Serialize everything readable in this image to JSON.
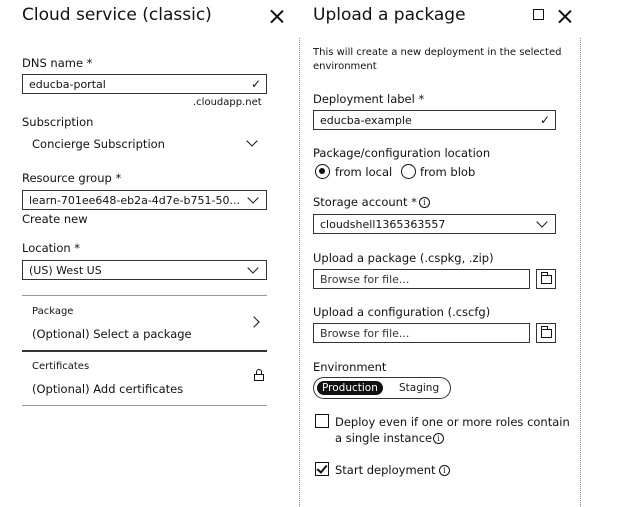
{
  "left_blade": {
    "title": "Cloud service (classic)",
    "dns": {
      "label": "DNS name *",
      "value": "educba-portal",
      "suffix": ".cloudapp.net"
    },
    "subscription": {
      "label": "Subscription",
      "value": "Concierge Subscription"
    },
    "resource_group": {
      "label": "Resource group *",
      "value": "learn-701ee648-eb2a-4d7e-b751-50...",
      "create_new": "Create new"
    },
    "location": {
      "label": "Location *",
      "value": "(US) West US"
    },
    "package": {
      "title": "Package",
      "value": "(Optional) Select a package"
    },
    "certificates": {
      "title": "Certificates",
      "value": "(Optional) Add certificates"
    }
  },
  "right_blade": {
    "title": "Upload a package",
    "description": "This will create a new deployment in the selected environment",
    "deployment_label": {
      "label": "Deployment label *",
      "value": "educba-example"
    },
    "location": {
      "label": "Package/configuration location",
      "options": [
        "from local",
        "from blob"
      ],
      "selected": "from local"
    },
    "storage": {
      "label": "Storage account *",
      "value": "cloudshell1365363557"
    },
    "upload_package": {
      "label": "Upload a package (.cspkg, .zip)",
      "placeholder": "Browse for file..."
    },
    "upload_config": {
      "label": "Upload a configuration (.cscfg)",
      "placeholder": "Browse for file..."
    },
    "environment": {
      "label": "Environment",
      "options": [
        "Production",
        "Staging"
      ],
      "selected": "Production"
    },
    "deploy_even": {
      "label_line1": "Deploy even if one or more roles contain",
      "label_line2": "a single instance",
      "checked": false
    },
    "start_deployment": {
      "label": "Start deployment",
      "checked": true
    }
  },
  "icons": {
    "close": "close-icon",
    "maximize": "maximize-icon",
    "check": "check-icon",
    "chevron_down": "chevron-down-icon",
    "chevron_right": "chevron-right-icon",
    "lock": "lock-icon",
    "info": "info-icon",
    "folder": "folder-icon"
  }
}
